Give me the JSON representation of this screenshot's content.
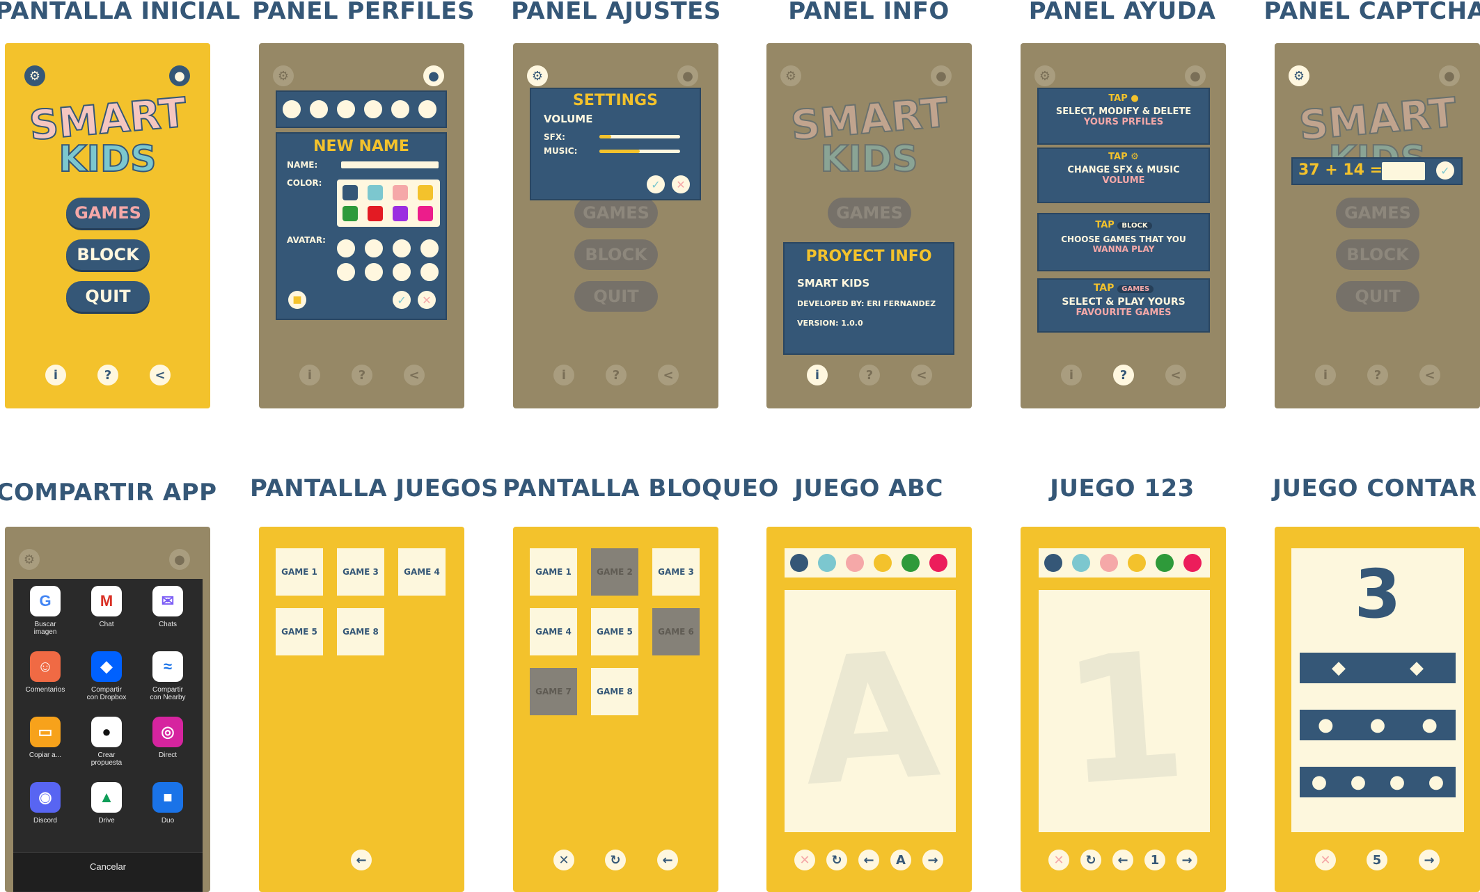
{
  "colors": {
    "yellow": "#f3c22c",
    "olive": "#968866",
    "navy": "#355777",
    "cream": "#fdf7dd",
    "pink": "#f5a8a8",
    "teal": "#7cc7cf"
  },
  "labels": {
    "s1": "PANTALLA INICIAL",
    "s2": "PANEL PERFILES",
    "s3": "PANEL AJUSTES",
    "s4": "PANEL INFO",
    "s5": "PANEL AYUDA",
    "s6": "PANEL CAPTCHA",
    "s7": "COMPARTIR APP",
    "s8": "PANTALLA JUEGOS",
    "s9": "PANTALLA BLOQUEO",
    "s10": "JUEGO ABC",
    "s11": "JUEGO 123",
    "s12": "JUEGO CONTAR"
  },
  "logo": {
    "line1": "SMART",
    "line2": "KIDS"
  },
  "menu": {
    "games": "GAMES",
    "block": "BLOCK",
    "quit": "QUIT"
  },
  "bottom_icons": [
    "info-icon",
    "help-icon",
    "share-icon"
  ],
  "profiles": {
    "title": "NEW NAME",
    "name_label": "NAME:",
    "color_label": "COLOR:",
    "avatar_label": "AVATAR:",
    "colors": [
      "#355777",
      "#7cc7cf",
      "#f5a8a8",
      "#f3c22c",
      "#2e9a3a",
      "#e31b23",
      "#9b2fe0",
      "#ec1d8b"
    ]
  },
  "settings": {
    "title": "SETTINGS",
    "volume": "VOLUME",
    "sfx": "SFX:",
    "music": "MUSIC:",
    "sfx_level": 0.15,
    "music_level": 0.5
  },
  "info": {
    "title": "PROYECT INFO",
    "app": "SMART KIDS",
    "dev": "DEVELOPED BY: ERI FERNANDEZ",
    "version": "VERSION: 1.0.0"
  },
  "help": {
    "tap": "TAP",
    "b1_line1": "SELECT, MODIFY & DELETE",
    "b1_line2": "YOURS PRFILES",
    "b2_line1": "CHANGE  SFX & MUSIC",
    "b2_line2": "VOLUME",
    "b3_badge": "BLOCK",
    "b3_line1": "CHOOSE GAMES  THAT YOU",
    "b3_line2": "WANNA PLAY",
    "b4_badge": "GAMES",
    "b4_line1": "SELECT & PLAY YOURS",
    "b4_line2": "FAVOURITE GAMES"
  },
  "captcha": {
    "question": "37 + 14 ="
  },
  "share": {
    "items": [
      {
        "label": "Buscar\nimagen",
        "icon": "google-icon",
        "color": "#ffffff",
        "glyph": "G",
        "fg": "#4285f4"
      },
      {
        "label": "Chat",
        "icon": "gmail-icon",
        "color": "#ffffff",
        "glyph": "M",
        "fg": "#d93025"
      },
      {
        "label": "Chats",
        "icon": "messenger-icon",
        "color": "#ffffff",
        "glyph": "✉",
        "fg": "#7b5cf5"
      },
      {
        "label": "Comentarios",
        "icon": "feedback-icon",
        "color": "#f06a44",
        "glyph": "☺",
        "fg": "#ffffff"
      },
      {
        "label": "Compartir\ncon Dropbox",
        "icon": "dropbox-icon",
        "color": "#0061fe",
        "glyph": "◆",
        "fg": "#ffffff"
      },
      {
        "label": "Compartir\ncon Nearby",
        "icon": "nearby-icon",
        "color": "#ffffff",
        "glyph": "≈",
        "fg": "#1a73e8"
      },
      {
        "label": "Copiar a...",
        "icon": "folder-icon",
        "color": "#f7a21b",
        "glyph": "▭",
        "fg": "#ffffff"
      },
      {
        "label": "Crear\npropuesta",
        "icon": "github-icon",
        "color": "#ffffff",
        "glyph": "●",
        "fg": "#111111"
      },
      {
        "label": "Direct",
        "icon": "instagram-icon",
        "color": "#d6249f",
        "glyph": "◎",
        "fg": "#ffffff"
      },
      {
        "label": "Discord",
        "icon": "discord-icon",
        "color": "#5865f2",
        "glyph": "◉",
        "fg": "#ffffff"
      },
      {
        "label": "Drive",
        "icon": "drive-icon",
        "color": "#ffffff",
        "glyph": "▲",
        "fg": "#0f9d58"
      },
      {
        "label": "Duo",
        "icon": "duo-icon",
        "color": "#1a73e8",
        "glyph": "■",
        "fg": "#ffffff"
      }
    ],
    "cancel": "Cancelar"
  },
  "games": {
    "list": [
      "GAME 1",
      "GAME 3",
      "GAME 4",
      "GAME 5",
      "GAME 8"
    ]
  },
  "lock": {
    "list": [
      {
        "label": "GAME 1",
        "blocked": false
      },
      {
        "label": "GAME 2",
        "blocked": true
      },
      {
        "label": "GAME 3",
        "blocked": false
      },
      {
        "label": "GAME 4",
        "blocked": false
      },
      {
        "label": "GAME 5",
        "blocked": false
      },
      {
        "label": "GAME 6",
        "blocked": true
      },
      {
        "label": "GAME 7",
        "blocked": true
      },
      {
        "label": "GAME 8",
        "blocked": false
      }
    ]
  },
  "abc": {
    "letter": "A",
    "current": "A",
    "dots": [
      "#355777",
      "#7cc7cf",
      "#f5a8a8",
      "#f3c22c",
      "#2e9a3a",
      "#ec1d5b"
    ]
  },
  "n123": {
    "number": "1",
    "current": "1"
  },
  "count": {
    "number": "3",
    "current": "5"
  }
}
